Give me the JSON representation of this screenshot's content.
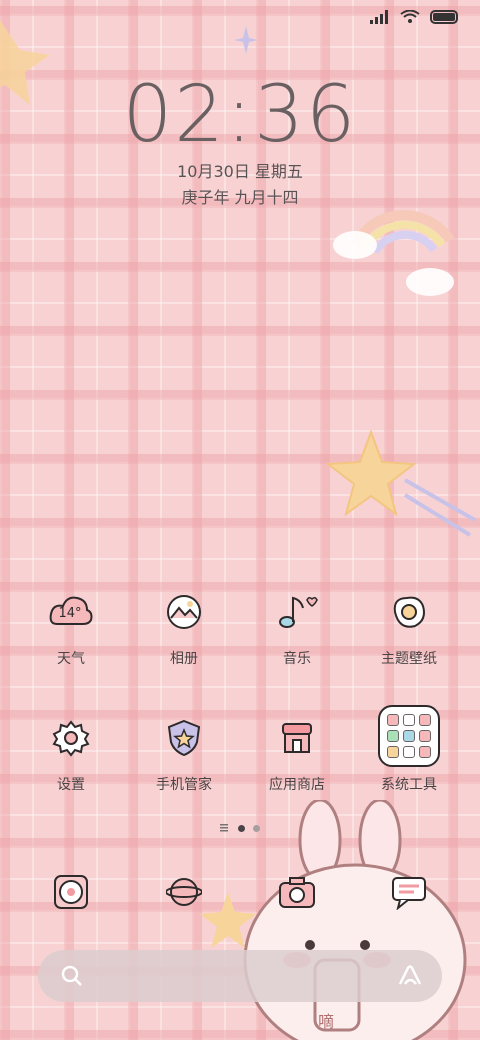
{
  "status_bar": {
    "icons": [
      "signal-icon",
      "wifi-icon",
      "battery-icon"
    ]
  },
  "lockscreen": {
    "time": "02:36",
    "date": "10月30日 星期五",
    "lunar": "庚子年 九月十四"
  },
  "apps_row1": [
    {
      "label": "天气",
      "icon": "weather-cloud-icon",
      "badge": "14°"
    },
    {
      "label": "相册",
      "icon": "gallery-icon"
    },
    {
      "label": "音乐",
      "icon": "music-note-icon"
    },
    {
      "label": "主题壁纸",
      "icon": "egg-theme-icon"
    }
  ],
  "apps_row2": [
    {
      "label": "设置",
      "icon": "gear-icon"
    },
    {
      "label": "手机管家",
      "icon": "shield-star-icon"
    },
    {
      "label": "应用商店",
      "icon": "store-icon"
    },
    {
      "label": "系统工具",
      "icon": "folder-icon"
    }
  ],
  "pager": {
    "pages": 3,
    "current": 2
  },
  "dock": [
    {
      "icon": "phone-dial-icon"
    },
    {
      "icon": "planet-browser-icon"
    },
    {
      "icon": "camera-icon"
    },
    {
      "icon": "message-bubble-icon"
    }
  ],
  "bunny_tag": "嘀",
  "colors": {
    "background": "#f8d2d3",
    "text": "#4a4446",
    "clock": "#6a6062"
  }
}
